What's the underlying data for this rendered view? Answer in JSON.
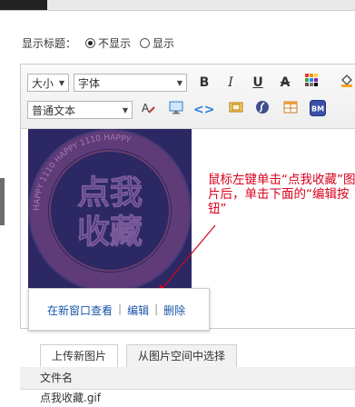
{
  "display_title": {
    "label": "显示标题：",
    "option_hide": "不显示",
    "option_show": "显示",
    "selected": "不显示"
  },
  "toolbar": {
    "size_select": "大小",
    "font_select": "字体",
    "format_select": "普通文本",
    "buttons": [
      "bold-icon",
      "italic-icon",
      "underline-icon",
      "strikethrough-icon",
      "color-grid-icon",
      "fill-icon",
      "eraser-icon",
      "image-icon",
      "code-icon",
      "media-icon",
      "flash-icon",
      "table-icon",
      "bm-icon"
    ],
    "bm_label": "BM"
  },
  "image": {
    "line1": "点我",
    "line2": "收藏",
    "ring_text": "HAPPY 1110 HAPPY 1110 HAPPY"
  },
  "popup": {
    "view_link": "在新窗口查看",
    "edit_link": "编辑",
    "delete_link": "删除",
    "separator": "|"
  },
  "annotation": {
    "text": "鼠标左键单击“点我收藏”图片后，单击下面的“编辑按钮”",
    "color": "#d9001b"
  },
  "tabs": {
    "upload": "上传新图片",
    "from_space": "从图片空间中选择"
  },
  "file_table": {
    "header": "文件名",
    "row": "点我收藏.gif"
  }
}
